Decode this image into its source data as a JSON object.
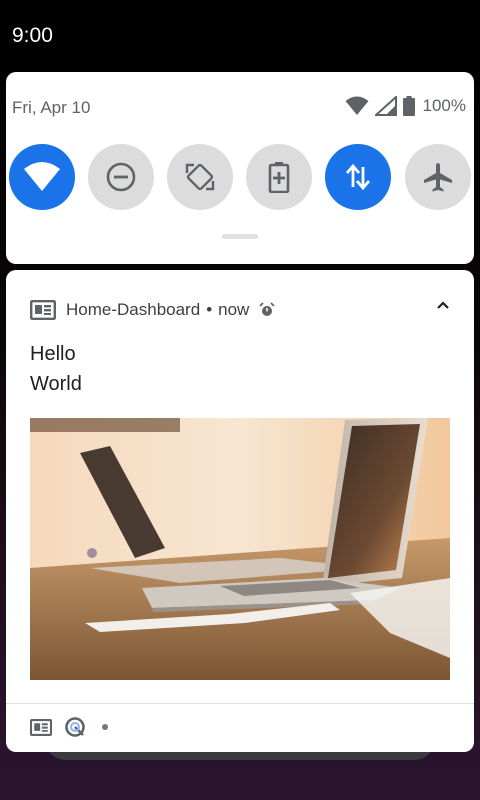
{
  "status_bar": {
    "time": "9:00"
  },
  "quick_settings": {
    "date": "Fri, Apr 10",
    "battery_percent": "100%",
    "tiles": [
      {
        "name": "wifi",
        "icon": "wifi-icon",
        "active": true
      },
      {
        "name": "do-not-disturb",
        "icon": "do-not-disturb-icon",
        "active": false
      },
      {
        "name": "auto-rotate",
        "icon": "auto-rotate-icon",
        "active": false
      },
      {
        "name": "battery-saver",
        "icon": "battery-saver-icon",
        "active": false
      },
      {
        "name": "mobile-data",
        "icon": "mobile-data-icon",
        "active": true
      },
      {
        "name": "airplane-mode",
        "icon": "airplane-icon",
        "active": false
      }
    ]
  },
  "notification": {
    "app_name": "Home-Dashboard",
    "separator": "•",
    "time": "now",
    "title": "Hello",
    "text": "World"
  },
  "colors": {
    "accent": "#1a73e8",
    "tile_inactive": "#dcdcdc",
    "icon_gray": "#5f6368"
  }
}
